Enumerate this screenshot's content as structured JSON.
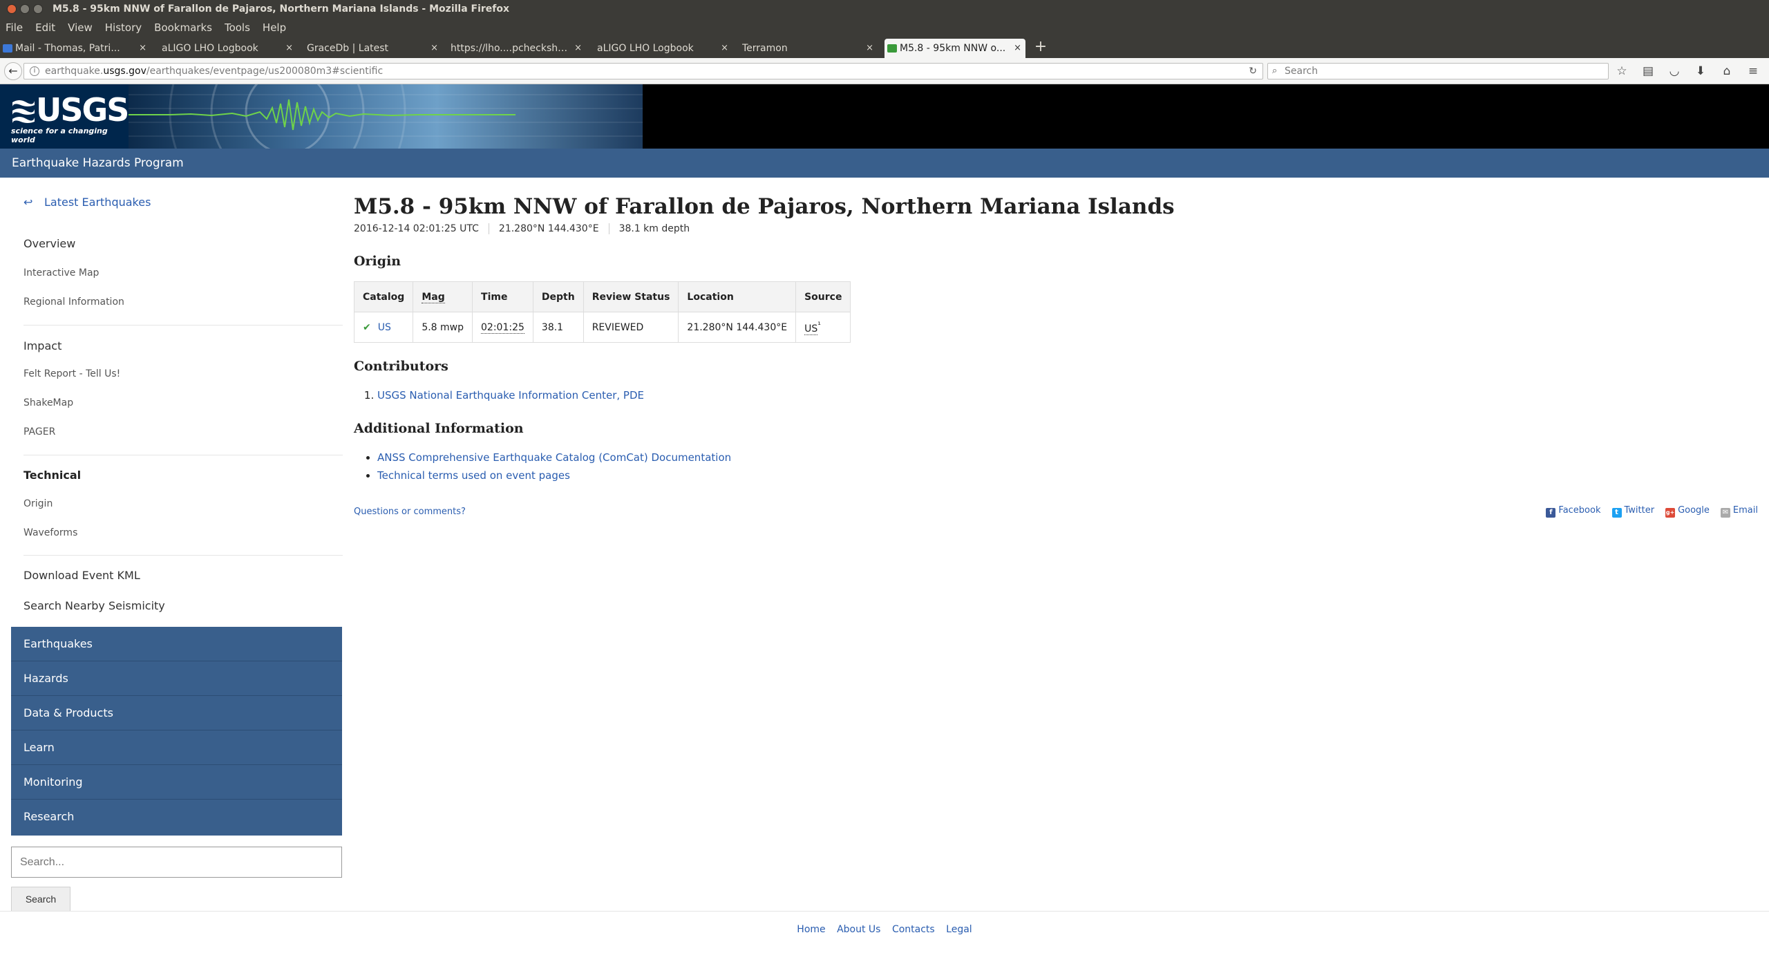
{
  "window": {
    "title": "M5.8 - 95km NNW of Farallon de Pajaros, Northern Mariana Islands - Mozilla Firefox"
  },
  "menu": [
    "File",
    "Edit",
    "View",
    "History",
    "Bookmarks",
    "Tools",
    "Help"
  ],
  "tabs": [
    {
      "label": "Mail - Thomas, Patri...",
      "close": "×"
    },
    {
      "label": "aLIGO LHO Logbook",
      "close": "×"
    },
    {
      "label": "GraceDb | Latest",
      "close": "×"
    },
    {
      "label": "https://lho....pchecksheet",
      "close": "×"
    },
    {
      "label": "aLIGO LHO Logbook",
      "close": "×"
    },
    {
      "label": "Terramon",
      "close": "×"
    },
    {
      "label": "M5.8 - 95km NNW o...",
      "close": "×"
    }
  ],
  "newtab": "+",
  "nav": {
    "url_prefix": "earthquake.",
    "url_domain": "usgs.gov",
    "url_path": "/earthquakes/eventpage/us200080m3#scientific",
    "search_placeholder": "Search"
  },
  "site": {
    "logo_text": "USGS",
    "logo_tagline": "science for a changing world",
    "program": "Earthquake Hazards Program"
  },
  "leftnav": {
    "back_label": "Latest Earthquakes",
    "overview": "Overview",
    "interactive_map": "Interactive Map",
    "regional_info": "Regional Information",
    "impact": "Impact",
    "felt_report": "Felt Report - Tell Us!",
    "shakemap": "ShakeMap",
    "pager": "PAGER",
    "technical": "Technical",
    "origin": "Origin",
    "waveforms": "Waveforms",
    "download_kml": "Download Event KML",
    "search_nearby": "Search Nearby Seismicity"
  },
  "sitenav": [
    "Earthquakes",
    "Hazards",
    "Data & Products",
    "Learn",
    "Monitoring",
    "Research"
  ],
  "search": {
    "placeholder": "Search...",
    "button": "Search"
  },
  "event": {
    "title": "M5.8 - 95km NNW of Farallon de Pajaros, Northern Mariana Islands",
    "datetime": "2016-12-14 02:01:25 UTC",
    "coords": "21.280°N  144.430°E",
    "depth": "38.1 km depth"
  },
  "origin": {
    "heading": "Origin",
    "columns": [
      "Catalog",
      "Mag",
      "Time",
      "Depth",
      "Review Status",
      "Location",
      "Source"
    ],
    "row": {
      "catalog": "US",
      "mag": "5.8 mwp",
      "time": "02:01:25",
      "depth": "38.1",
      "review_status": "REVIEWED",
      "location": "21.280°N 144.430°E",
      "source": "US",
      "source_suffix": "¹"
    }
  },
  "contributors": {
    "heading": "Contributors",
    "items": [
      "USGS National Earthquake Information Center, PDE"
    ]
  },
  "additional": {
    "heading": "Additional Information",
    "items": [
      "ANSS Comprehensive Earthquake Catalog (ComCat) Documentation",
      "Technical terms used on event pages"
    ]
  },
  "questions": "Questions or comments?",
  "social": [
    {
      "label": "Facebook",
      "icon": "f",
      "color": "#3b5998"
    },
    {
      "label": "Twitter",
      "icon": "t",
      "color": "#1da1f2"
    },
    {
      "label": "Google",
      "icon": "g+",
      "color": "#dd4b39"
    },
    {
      "label": "Email",
      "icon": "✉",
      "color": "#aaaaaa"
    }
  ],
  "footer": [
    "Home",
    "About Us",
    "Contacts",
    "Legal"
  ]
}
